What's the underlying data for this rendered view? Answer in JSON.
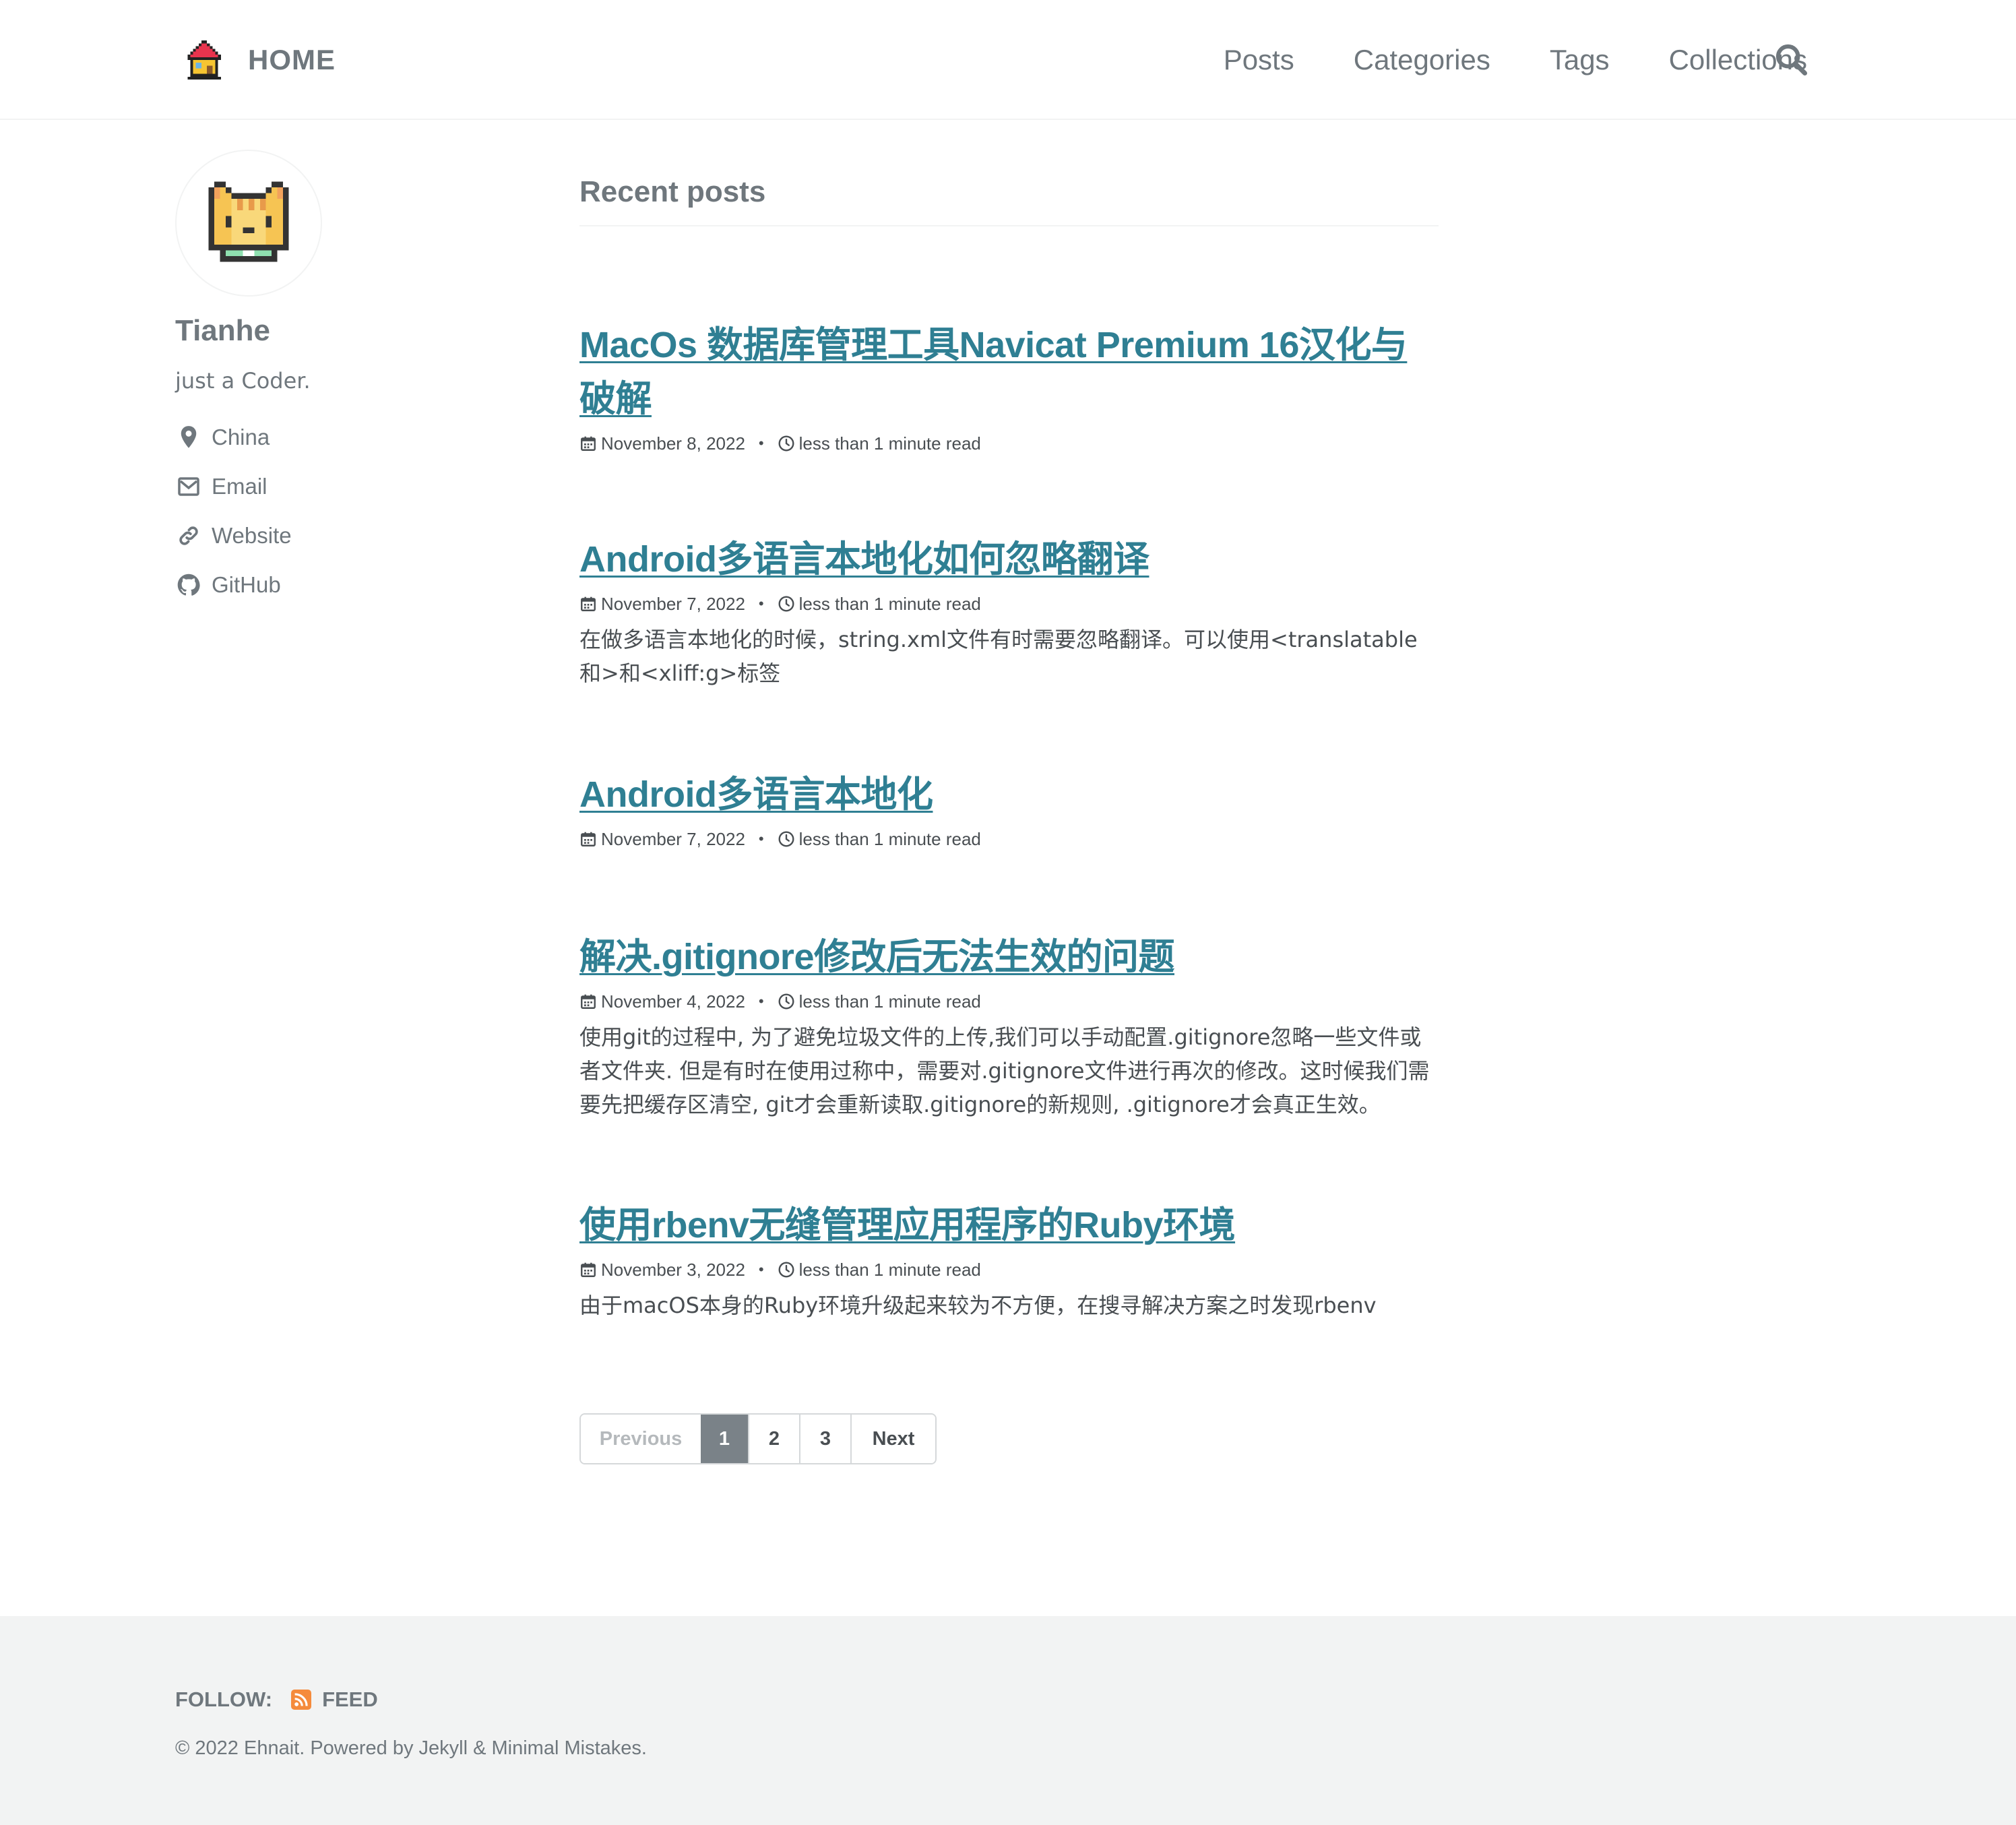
{
  "masthead": {
    "title": "HOME",
    "nav": [
      "Posts",
      "Categories",
      "Tags",
      "Collections"
    ],
    "logo_icon": "house-icon",
    "search_icon": "search-icon"
  },
  "author": {
    "name": "Tianhe",
    "bio": "just a Coder.",
    "avatar_icon": "pixel-cat-icon",
    "links": [
      {
        "icon": "location-icon",
        "label": "China"
      },
      {
        "icon": "envelope-icon",
        "label": "Email"
      },
      {
        "icon": "link-icon",
        "label": "Website"
      },
      {
        "icon": "github-icon",
        "label": "GitHub"
      }
    ]
  },
  "archive": {
    "title": "Recent posts",
    "posts": [
      {
        "title": "MacOs 数据库管理工具Navicat Premium 16汉化与破解",
        "date": "November 8, 2022",
        "read_time": "less than 1 minute read",
        "excerpt": ""
      },
      {
        "title": "Android多语言本地化如何忽略翻译",
        "date": "November 7, 2022",
        "read_time": "less than 1 minute read",
        "excerpt": "在做多语言本地化的时候，string.xml文件有时需要忽略翻译。可以使用<translatable和>和<xliff:g>标签"
      },
      {
        "title": "Android多语言本地化",
        "date": "November 7, 2022",
        "read_time": "less than 1 minute read",
        "excerpt": ""
      },
      {
        "title": "解决.gitignore修改后无法生效的问题",
        "date": "November 4, 2022",
        "read_time": "less than 1 minute read",
        "excerpt": "使用git的过程中, 为了避免垃圾文件的上传,我们可以手动配置.gitignore忽略一些文件或者文件夹. 但是有时在使用过称中，需要对.gitignore文件进行再次的修改。这时候我们需要先把缓存区清空, git才会重新读取.gitignore的新规则, .gitignore才会真正生效。"
      },
      {
        "title": "使用rbenv无缝管理应用程序的Ruby环境",
        "date": "November 3, 2022",
        "read_time": "less than 1 minute read",
        "excerpt": "由于macOS本身的Ruby环境升级起来较为不方便，在搜寻解决方案之时发现rbenv"
      }
    ]
  },
  "pagination": {
    "previous": "Previous",
    "pages": [
      "1",
      "2",
      "3"
    ],
    "current": "1",
    "next": "Next"
  },
  "footer": {
    "follow_label": "FOLLOW:",
    "feed_label": "FEED",
    "feed_icon": "rss-icon",
    "copyright": "© 2022 Ehnait. Powered by Jekyll & Minimal Mistakes."
  },
  "colors": {
    "link": "#2f7f93",
    "text": "#494e52",
    "muted": "#6f777d",
    "footer_bg": "#f2f3f3",
    "rss": "#f58b3c"
  }
}
